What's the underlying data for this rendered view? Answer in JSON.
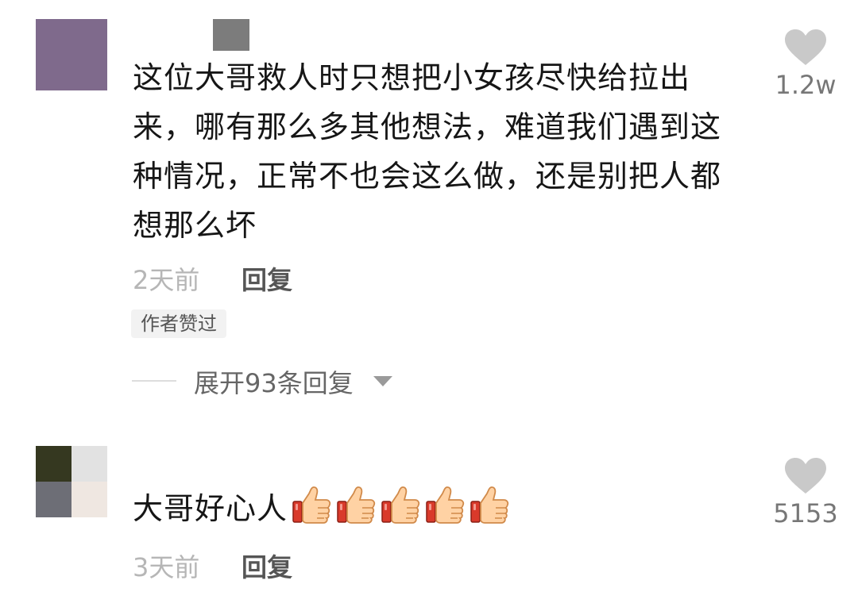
{
  "comments": [
    {
      "text": "这位大哥救人时只想把小女孩尽快给拉出来，哪有那么多其他想法，难道我们遇到这种情况，正常不也会这么做，还是别把人都想那么坏",
      "time": "2天前",
      "reply_label": "回复",
      "author_badge": "作者赞过",
      "expand_label": "展开93条回复",
      "likes": "1.2w"
    },
    {
      "text": "大哥好心人",
      "emoji": "thumbs-up",
      "emoji_count": 5,
      "time": "3天前",
      "reply_label": "回复",
      "likes": "5153"
    }
  ],
  "colors": {
    "avatar_1": "#7f6a8c",
    "avatar_2": [
      "#353820",
      "#e2e2e2",
      "#6d6e76",
      "#efe7e1"
    ],
    "username_placeholder": "#7c7c7c",
    "heart_icon": "#c9c9c9"
  },
  "icons": [
    "heart-icon",
    "thumbs-up-icon",
    "chevron-down-icon"
  ]
}
